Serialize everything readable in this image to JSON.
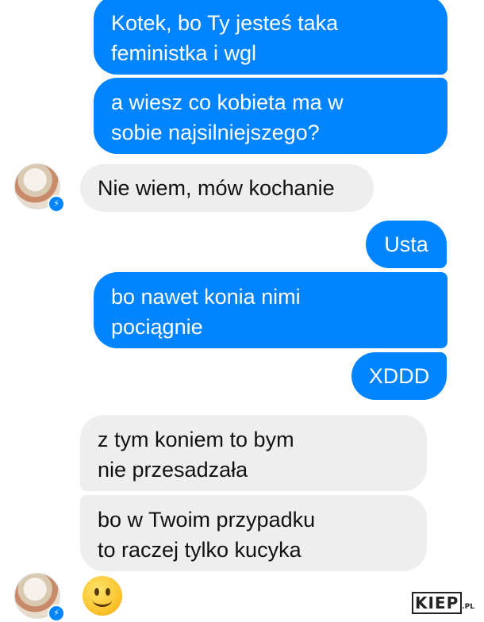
{
  "messages": [
    {
      "side": "out",
      "text": "Kotek, bo Ty jesteś taka\nfeministka i wgl"
    },
    {
      "side": "out",
      "text": "a wiesz co kobieta ma w\nsobie najsilniejszego?"
    },
    {
      "side": "in",
      "text": "Nie wiem, mów kochanie"
    },
    {
      "side": "out",
      "text": "Usta"
    },
    {
      "side": "out",
      "text": "bo nawet konia nimi\npociągnie"
    },
    {
      "side": "out",
      "text": "XDDD"
    },
    {
      "side": "in",
      "text": "z tym koniem to bym\nnie przesadzała"
    },
    {
      "side": "in",
      "text": "bo w Twoim przypadku\nto raczej tylko kucyka"
    },
    {
      "side": "in",
      "emoji": "slightly-smiling-face-emoji"
    }
  ],
  "colors": {
    "outgoing": "#0084ff",
    "incoming": "#eeeeee"
  },
  "icons": {
    "messenger_badge": "messenger-icon"
  },
  "watermark": {
    "main": "KIEP",
    "suffix": ".PL"
  }
}
